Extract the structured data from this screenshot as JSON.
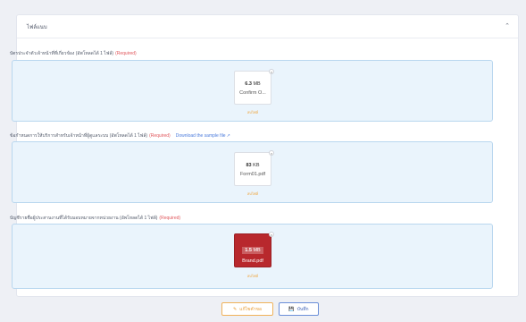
{
  "card": {
    "title": "ไฟล์แนบ",
    "collapse_icon": "chevron-up-icon"
  },
  "sections": [
    {
      "label": "บัตรประจำตัวเจ้าหน้าที่ที่เกี่ยวข้อง (อัพโหลดได้ 1 ไฟล์)",
      "required": "(Required)",
      "file": {
        "size_value": "6.3",
        "size_unit": "MB",
        "name": "Confirm O...",
        "remove_label": "ลบไฟล์"
      }
    },
    {
      "label": "ข้อกำหนดการให้บริการสำหรับเจ้าหน้าที่ผู้ดูแลระบบ (อัพโหลดได้ 1 ไฟล์)",
      "required": "(Required)",
      "link": "Download the sample file",
      "file": {
        "size_value": "83",
        "size_unit": "KB",
        "name": "Form01.pdf",
        "remove_label": "ลบไฟล์"
      }
    },
    {
      "label": "บัญชีรายชื่อผู้ประสานงานที่ได้รับมอบหมายจากหน่วยงาน (อัพโหลดได้ 1 ไฟล์)",
      "required": "(Required)",
      "file": {
        "size_value": "1.5",
        "size_unit": "MB",
        "name": "Brand.pdf",
        "remove_label": "ลบไฟล์"
      }
    }
  ],
  "buttons": {
    "edit": "แก้ไขคำขอ",
    "save": "บันทึก"
  },
  "colors": {
    "required": "#e0565b",
    "link": "#4b7bdc",
    "dropzone_bg": "#eaf4fc",
    "edit_accent": "#e89a30",
    "save_accent": "#3f63b8"
  }
}
